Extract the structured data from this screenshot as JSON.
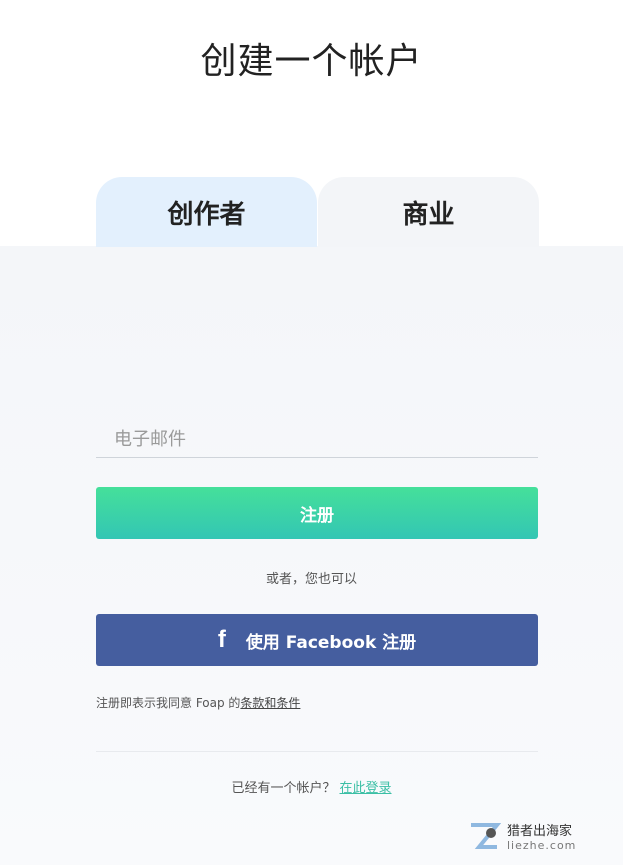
{
  "page": {
    "title": "创建一个帐户"
  },
  "tabs": [
    {
      "label": "创作者",
      "active": true
    },
    {
      "label": "商业",
      "active": false
    }
  ],
  "form": {
    "email_placeholder": "电子邮件",
    "email_value": "",
    "register_label": "注册",
    "or_text": "或者，您也可以",
    "facebook_label": "使用 Facebook 注册",
    "facebook_icon": "f",
    "terms_prefix": "注册即表示我同意 Foap 的",
    "terms_link": "条款和条件"
  },
  "login": {
    "prompt": "已经有一个帐户？",
    "link": "在此登录"
  },
  "watermark": {
    "main": "猎者出海家",
    "sub": "liezhe.com"
  },
  "colors": {
    "accent_green_top": "#45e09a",
    "accent_green_bottom": "#33c6b4",
    "facebook_blue": "#455e9f",
    "tab_active": "#e3f0fd",
    "link_teal": "#3bbfa5"
  }
}
